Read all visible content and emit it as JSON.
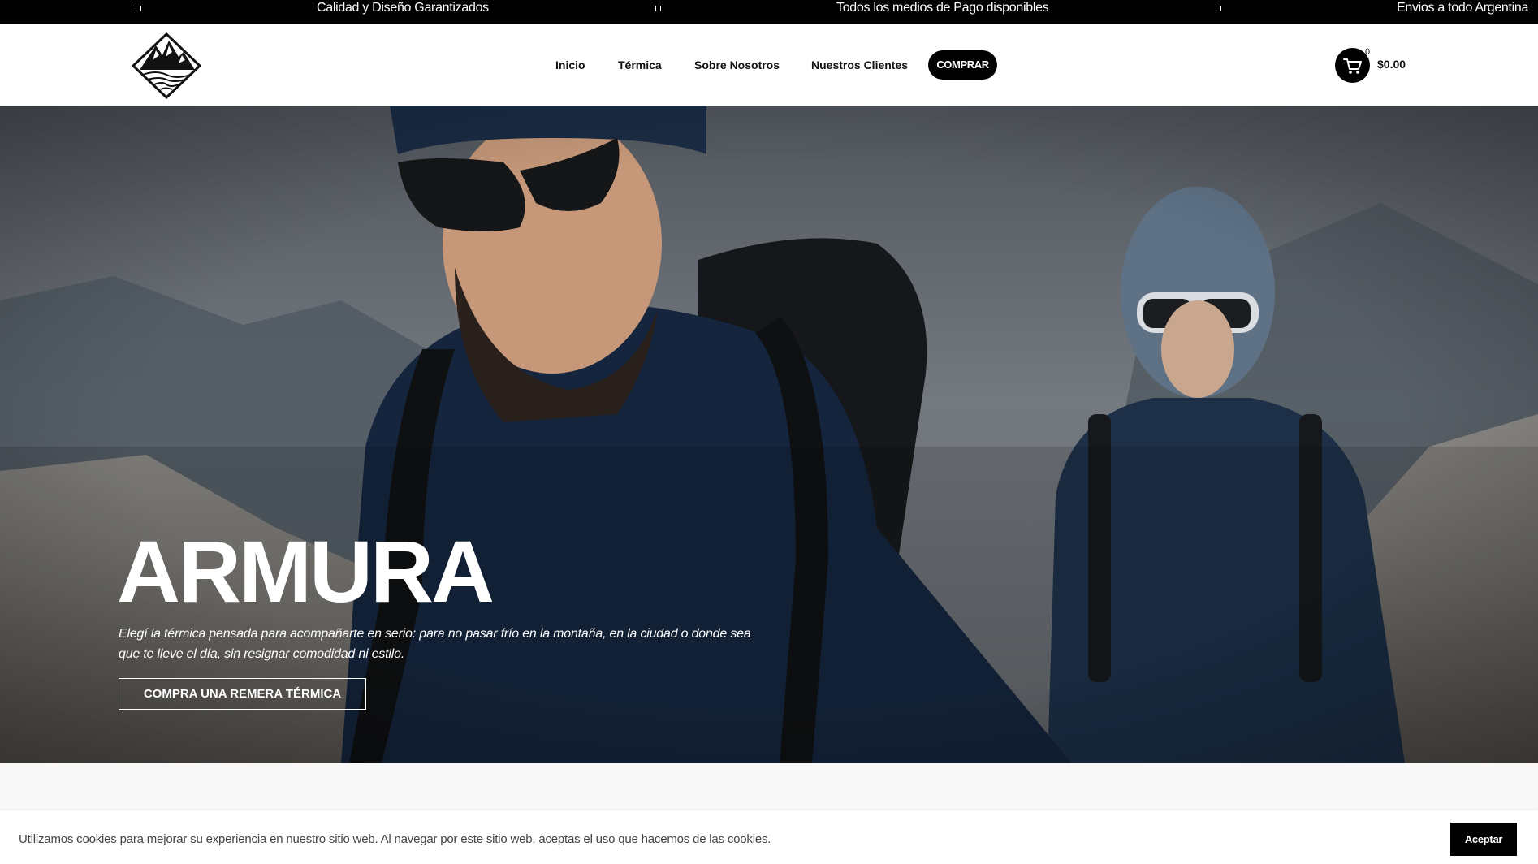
{
  "announcements": [
    "Calidad y Diseño Garantizados",
    "Todos los medios de Pago disponibles",
    "Envios a todo Argentina"
  ],
  "header": {
    "logo_icon": "mountain-logo-icon",
    "nav": [
      "Inicio",
      "Térmica",
      "Sobre Nosotros",
      "Nuestros Clientes"
    ],
    "buy_label": "COMPRAR",
    "cart_icon": "cart-icon",
    "cart_count": "0",
    "cart_total": "$0.00"
  },
  "hero": {
    "title": "ARMURA",
    "description": "Elegí la térmica pensada para acompañarte en serio: para no pasar frío en la montaña, en la ciudad o donde sea que te lleve el día, sin resignar comodidad ni estilo.",
    "cta": "COMPRA UNA REMERA TÉRMICA"
  },
  "cookie": {
    "text": "Utilizamos cookies para mejorar su experiencia en nuestro sitio web. Al navegar por este sitio web, aceptas el uso que hacemos de las cookies.",
    "accept": "Aceptar"
  },
  "colors": {
    "topbar": "#000000",
    "accent": "#000000",
    "shirt": "#14233b"
  }
}
